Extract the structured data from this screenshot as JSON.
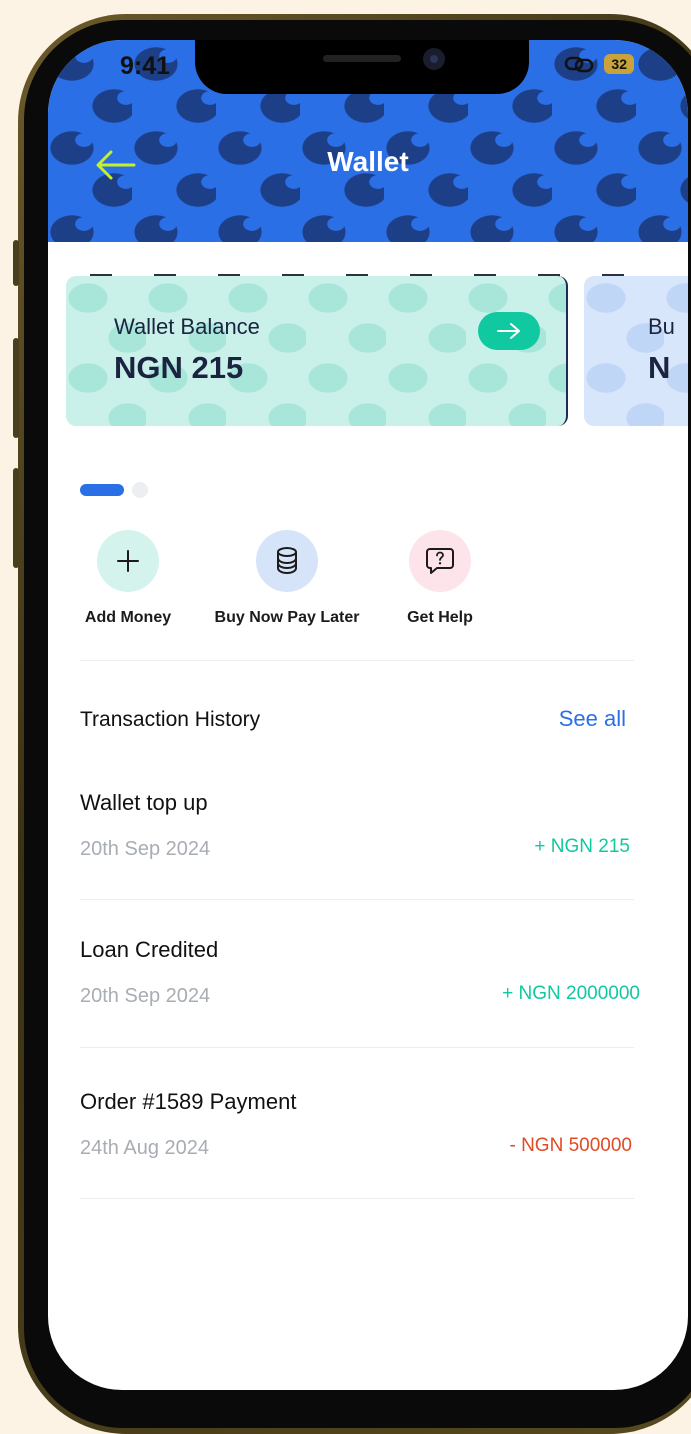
{
  "status_bar": {
    "time": "9:41",
    "battery": "32"
  },
  "header": {
    "title": "Wallet"
  },
  "cards": [
    {
      "label": "Wallet Balance",
      "amount": "NGN 215"
    },
    {
      "label": "Bu",
      "amount": "N"
    }
  ],
  "carousel": {
    "active_index": 0,
    "count": 2
  },
  "actions": [
    {
      "label": "Add Money",
      "icon": "plus-icon",
      "color": "#d4f3ec"
    },
    {
      "label": "Buy Now Pay Later",
      "icon": "coins-stack-icon",
      "color": "#d6e4fa"
    },
    {
      "label": "Get Help",
      "icon": "help-bubble-icon",
      "color": "#fde3ea"
    }
  ],
  "history": {
    "title": "Transaction History",
    "see_all": "See all",
    "items": [
      {
        "title": "Wallet top up",
        "date": "20th Sep 2024",
        "amount": "+ NGN 215",
        "type": "credit"
      },
      {
        "title": "Loan Credited",
        "date": "20th Sep 2024",
        "amount": "+ NGN 2000000",
        "type": "credit"
      },
      {
        "title": "Order #1589 Payment",
        "date": "24th Aug 2024",
        "amount": "- NGN 500000",
        "type": "debit"
      }
    ]
  },
  "colors": {
    "primary": "#2b6fe6",
    "credit": "#10c9a0",
    "debit": "#e04a25",
    "back_arrow": "#c6f02a"
  }
}
